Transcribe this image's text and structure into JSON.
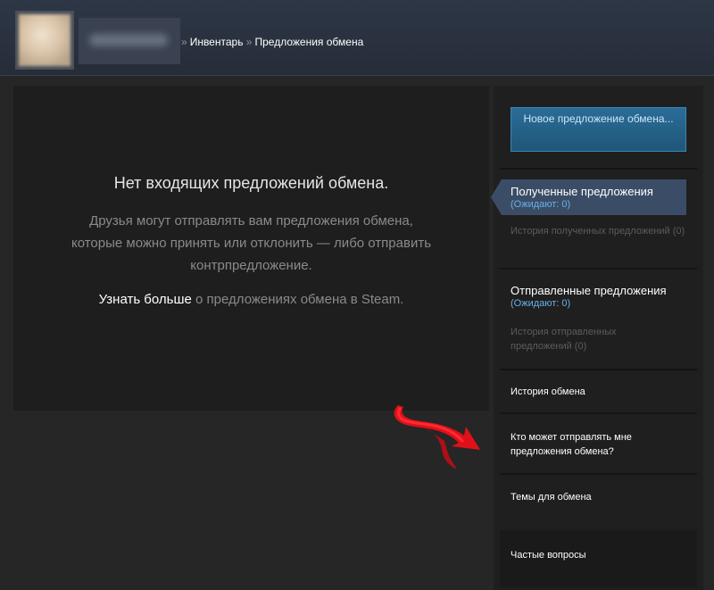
{
  "header": {
    "breadcrumb": {
      "separator": "»",
      "inventory": "Инвентарь",
      "current": "Предложения обмена"
    }
  },
  "main": {
    "empty_title": "Нет входящих предложений обмена.",
    "empty_description": "Друзья могут отправлять вам предложения обмена, которые можно принять или отклонить — либо отправить контрпредложение.",
    "learn_more_link": "Узнать больше",
    "learn_more_rest": " о предложениях обмена в Steam."
  },
  "sidebar": {
    "new_offer_button": "Новое предложение обмена...",
    "received": {
      "title": "Полученные предложения",
      "count": "(Ожидают: 0)",
      "history": "История полученных предложений (0)"
    },
    "sent": {
      "title": "Отправленные предложения",
      "count": "(Ожидают: 0)",
      "history": "История отправленных предложений (0)"
    },
    "trade_history": "История обмена",
    "who_can_send": "Кто может отправлять мне предложения обмена?",
    "trading_topics": "Темы для обмена",
    "faq": "Частые вопросы"
  },
  "colors": {
    "accent_blue": "#66b2e8",
    "button_blue": "#2a6d98",
    "active_item": "#3b4d66",
    "annotation_red": "#e0101a"
  },
  "icons": {
    "annotation": "red-arrow-icon"
  }
}
